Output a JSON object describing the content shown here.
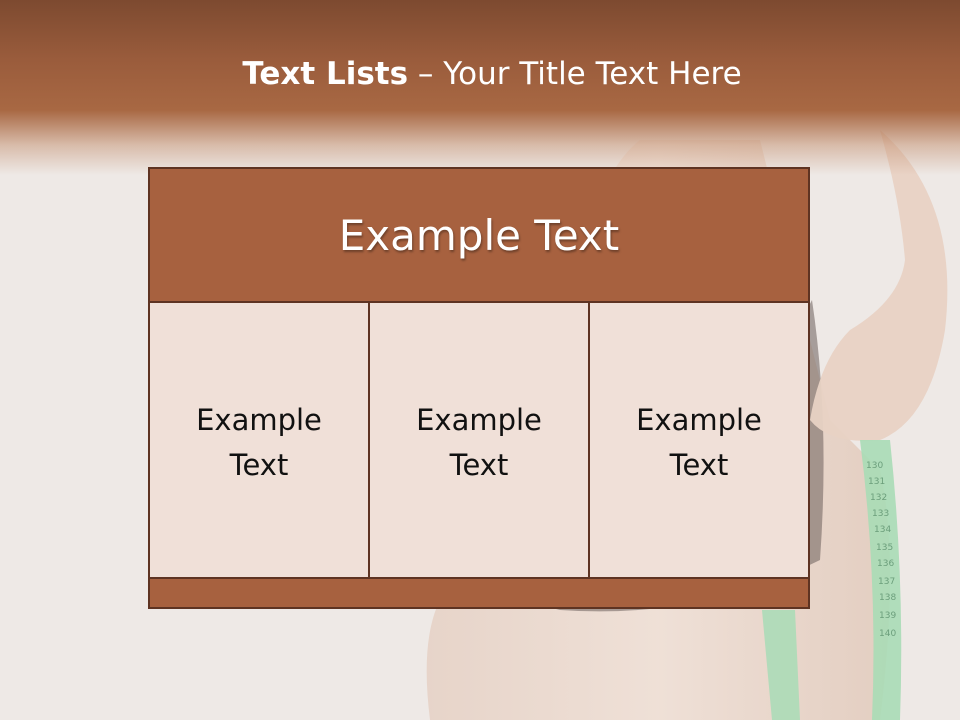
{
  "slide": {
    "title_strong": "Text Lists",
    "title_rest": " – Your Title Text Here"
  },
  "table": {
    "header": "Example Text",
    "cells": [
      {
        "label": "Example Text"
      },
      {
        "label": "Example Text"
      },
      {
        "label": "Example Text"
      }
    ]
  },
  "colors": {
    "accent": "#a7613f",
    "border": "#5e3322",
    "cell_fill": "#f0e0d8"
  }
}
